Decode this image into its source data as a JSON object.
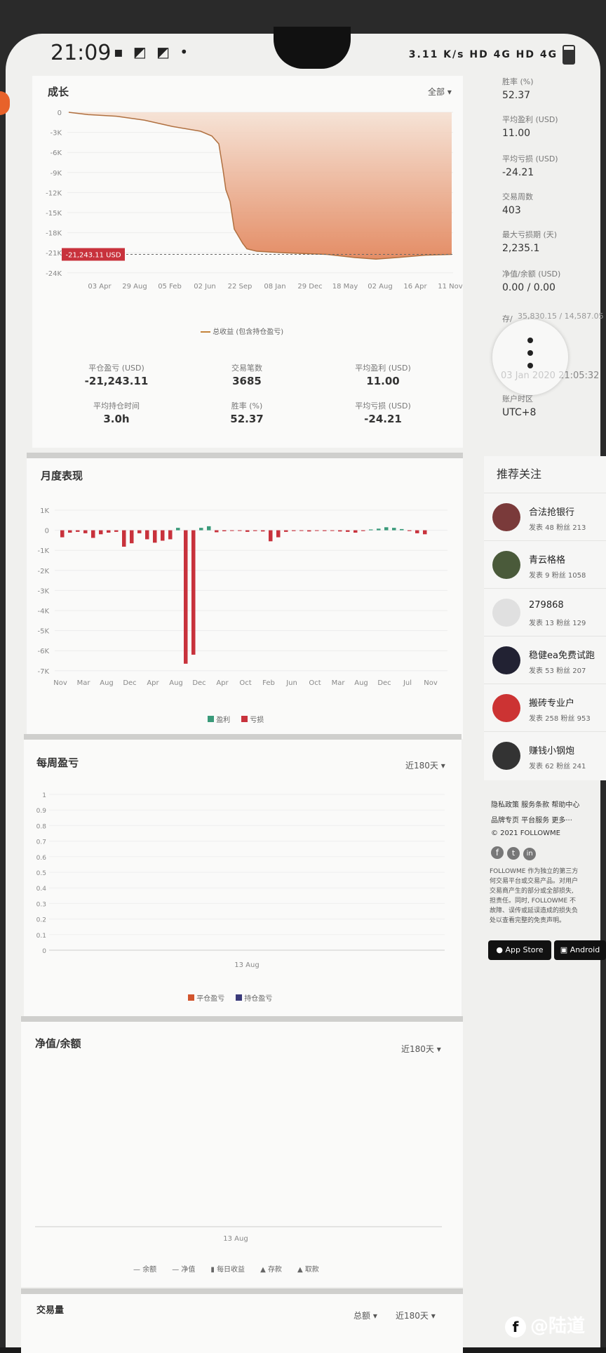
{
  "status_bar": {
    "time": "21:09",
    "speed": "3.11 K/s",
    "right": "HD 4G HD 4G"
  },
  "growth": {
    "title": "成长",
    "filter": "全部 ▾",
    "y_ticks": [
      "0",
      "-3K",
      "-6K",
      "-9K",
      "-12K",
      "-15K",
      "-18K",
      "-21K",
      "-24K"
    ],
    "x_ticks": [
      "03 Apr",
      "29 Aug",
      "05 Feb",
      "02 Jun",
      "22 Sep",
      "08 Jan",
      "29 Dec",
      "18 May",
      "02 Aug",
      "16 Apr",
      "11 Nov"
    ],
    "marker": "-21,243.11 USD",
    "legend": "总收益 (包含持仓盈亏)",
    "stats": [
      {
        "label": "平仓盈亏 (USD)",
        "value": "-21,243.11"
      },
      {
        "label": "交易笔数",
        "value": "3685"
      },
      {
        "label": "平均盈利 (USD)",
        "value": "11.00"
      },
      {
        "label": "平均持仓时间",
        "value": "3.0h"
      },
      {
        "label": "胜率 (%)",
        "value": "52.37"
      },
      {
        "label": "平均亏损 (USD)",
        "value": "-24.21"
      }
    ]
  },
  "monthly": {
    "title": "月度表现",
    "y_ticks": [
      "1K",
      "0",
      "-1K",
      "-2K",
      "-3K",
      "-4K",
      "-5K",
      "-6K",
      "-7K"
    ],
    "x_ticks": [
      "Nov",
      "Mar",
      "Aug",
      "Dec",
      "Apr",
      "Aug",
      "Dec",
      "Apr",
      "Oct",
      "Feb",
      "Jun",
      "Oct",
      "Mar",
      "Aug",
      "Dec",
      "Jul",
      "Nov"
    ],
    "legend_profit": "盈利",
    "legend_loss": "亏损"
  },
  "weekly": {
    "title": "每周盈亏",
    "filter": "近180天 ▾",
    "y_ticks": [
      "1",
      "0.9",
      "0.8",
      "0.7",
      "0.6",
      "0.5",
      "0.4",
      "0.3",
      "0.2",
      "0.1",
      "0"
    ],
    "x_label": "13 Aug",
    "legend_a": "平仓盈亏",
    "legend_b": "持仓盈亏"
  },
  "equity": {
    "title": "净值/余额",
    "filter": "近180天 ▾",
    "x_label": "13 Aug",
    "legend": [
      "余额",
      "净值",
      "每日收益",
      "存款",
      "取款"
    ]
  },
  "volume": {
    "title": "交易量",
    "filter1": "总额 ▾",
    "filter2": "近180天 ▾"
  },
  "right_stats": [
    {
      "label": "胜率 (%)",
      "value": "52.37"
    },
    {
      "label": "平均盈利 (USD)",
      "value": "11.00"
    },
    {
      "label": "平均亏损 (USD)",
      "value": "-24.21"
    },
    {
      "label": "交易周数",
      "value": "403"
    },
    {
      "label": "最大亏损期 (天)",
      "value": "2,235.1"
    },
    {
      "label": "净值/余额 (USD)",
      "value": "0.00 / 0.00"
    },
    {
      "label": "存/",
      "value": "35,830.15 / 14,587.05"
    },
    {
      "label": "",
      "value": "03 Jan 2020 21:05:32"
    },
    {
      "label": "账户时区",
      "value": "UTC+8"
    }
  ],
  "follow": {
    "title": "推荐关注",
    "items": [
      {
        "name": "合法抢银行",
        "meta": "发表 48  粉丝 213"
      },
      {
        "name": "青云格格",
        "meta": "发表 9  粉丝 1058"
      },
      {
        "name": "279868",
        "meta": "发表 13  粉丝 129"
      },
      {
        "name": "稳健ea免费试跑",
        "meta": "发表 53  粉丝 207"
      },
      {
        "name": "搬砖专业户",
        "meta": "发表 258  粉丝 953"
      },
      {
        "name": "赚钱小钢炮",
        "meta": "发表 62  粉丝 241"
      }
    ]
  },
  "footer": {
    "links1": "隐私政策  服务条款  帮助中心",
    "links2": "品牌专页  平台服务  更多···",
    "copyright": "© 2021 FOLLOWME",
    "disclaimer1": "FOLLOWME 作为独立的第三方",
    "disclaimer2": "何交易平台或交易产品。对用户",
    "disclaimer3": "交易商产生的部分或全部损失,",
    "disclaimer4": "担责任。同时, FOLLOWME 不",
    "disclaimer5": "故障、误传或延误造成的损失负",
    "disclaimer6": "处以查看完整的免责声明。",
    "appstore": "App Store",
    "android": "Android"
  },
  "watermark": "@陆道"
}
